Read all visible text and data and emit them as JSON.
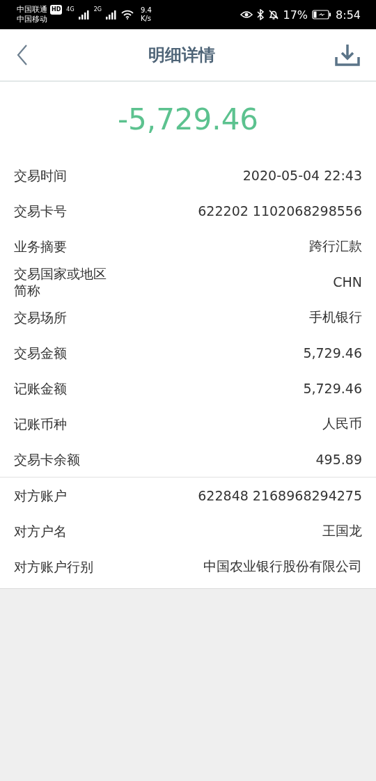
{
  "status_bar": {
    "carriers": [
      "中国联通",
      "中国移动"
    ],
    "hd_badge": "HD",
    "networks": [
      "4G",
      "2G"
    ],
    "speed": [
      "9.4",
      "K/s"
    ],
    "battery": "17%",
    "time": "8:54"
  },
  "header": {
    "title": "明细详情"
  },
  "amount": "-5,729.46",
  "sections": [
    {
      "rows": [
        {
          "label": "交易时间",
          "value": "2020-05-04 22:43"
        },
        {
          "label": "交易卡号",
          "value": "622202 1102068298556"
        },
        {
          "label": "业务摘要",
          "value": "跨行汇款"
        },
        {
          "label": "交易国家或地区简称",
          "value": "CHN"
        },
        {
          "label": "交易场所",
          "value": "手机银行"
        },
        {
          "label": "交易金额",
          "value": "5,729.46"
        },
        {
          "label": "记账金额",
          "value": "5,729.46"
        },
        {
          "label": "记账币种",
          "value": "人民币"
        },
        {
          "label": "交易卡余额",
          "value": "495.89"
        }
      ]
    },
    {
      "rows": [
        {
          "label": "对方账户",
          "value": "622848 2168968294275"
        },
        {
          "label": "对方户名",
          "value": "王国龙"
        },
        {
          "label": "对方账户行别",
          "value": "中国农业银行股份有限公司"
        }
      ]
    }
  ]
}
